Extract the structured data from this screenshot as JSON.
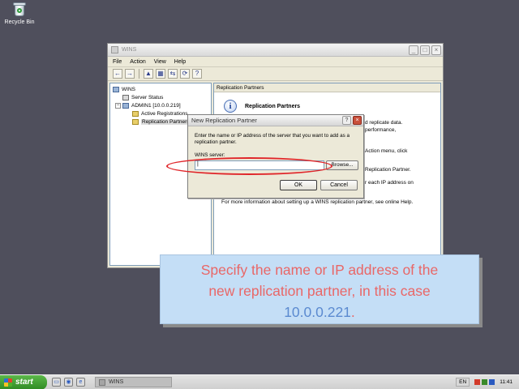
{
  "desktop": {
    "recycle_bin_label": "Recycle Bin"
  },
  "window": {
    "title": "WINS",
    "controls": {
      "minimize": "_",
      "maximize": "□",
      "close": "×"
    },
    "menu": [
      "File",
      "Action",
      "View",
      "Help"
    ],
    "toolbar": [
      "←",
      "→",
      "▲",
      "▦",
      "⇆",
      "⟳",
      "?"
    ],
    "tree": {
      "root": "WINS",
      "items": [
        "Server Status",
        "ADMIN1 [10.0.0.219]",
        "Active Registrations",
        "Replication Partners"
      ]
    },
    "detail": {
      "header": "Replication Partners",
      "heading": "Replication Partners",
      "lines": [
        "d replicate data.",
        "performance,",
        "Action menu, click",
        "Replication Partner.",
        "r each IP address on"
      ],
      "footer": "For more information about setting up a WINS replication partner, see online Help."
    }
  },
  "dialog": {
    "title": "New Replication Partner",
    "help": "?",
    "close": "×",
    "instructions": "Enter the name or IP address of the server that you want to add as a replication partner.",
    "label": "WINS server:",
    "input_value": "|",
    "browse": "Browse...",
    "ok": "OK",
    "cancel": "Cancel"
  },
  "caption": {
    "line1": "Specify the name or IP address of the",
    "line2": "new replication partner, in this case",
    "ip": "10.0.0.221",
    "end": "."
  },
  "taskbar": {
    "start": "start",
    "task": "WINS",
    "lang": "EN",
    "clock": "11:41"
  },
  "colors": {
    "caption_text": "#e96767",
    "caption_highlight": "#5b8ad0",
    "annotation": "#e0262a"
  }
}
